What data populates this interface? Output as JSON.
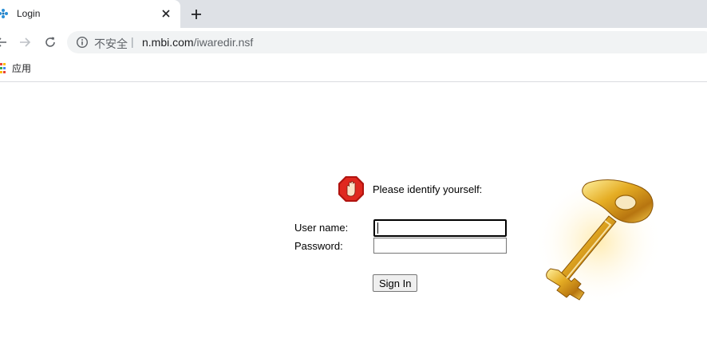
{
  "tab": {
    "title": "Login",
    "favicon": "lotus-notes-icon"
  },
  "toolbar": {
    "security_label": "不安全",
    "separator": "|",
    "url_host": "n.mbi.com",
    "url_path": "/iwaredir.nsf"
  },
  "bookmarks": {
    "apps_label": "应用"
  },
  "login": {
    "prompt": "Please identify yourself:",
    "username_label": "User name:",
    "password_label": "Password:",
    "username_value": "",
    "password_value": "",
    "sign_in_label": "Sign In"
  },
  "colors": {
    "tabstrip": "#dee1e6",
    "omnibox": "#f1f3f4",
    "stop_sign": "#cc1a14",
    "key_gold": "#d9a21a"
  }
}
